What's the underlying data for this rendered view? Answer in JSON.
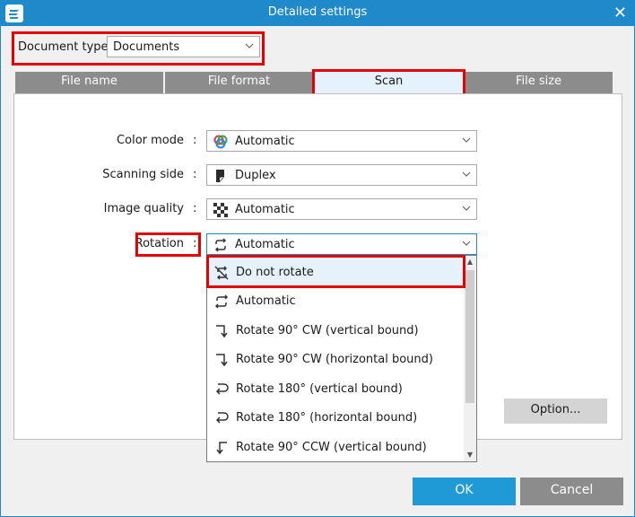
{
  "window": {
    "title": "Detailed settings"
  },
  "document_type": {
    "label": "Document type:",
    "value": "Documents"
  },
  "tabs": [
    {
      "label": "File name"
    },
    {
      "label": "File format"
    },
    {
      "label": "Scan"
    },
    {
      "label": "File size"
    }
  ],
  "fields": {
    "color_mode": {
      "label": "Color mode",
      "value": "Automatic"
    },
    "scanning_side": {
      "label": "Scanning side",
      "value": "Duplex"
    },
    "image_quality": {
      "label": "Image quality",
      "value": "Automatic"
    },
    "rotation": {
      "label": "Rotation",
      "value": "Automatic"
    }
  },
  "colon": ":",
  "rotation_options": [
    {
      "label": "Do not rotate"
    },
    {
      "label": "Automatic"
    },
    {
      "label": "Rotate 90° CW (vertical bound)"
    },
    {
      "label": "Rotate 90° CW (horizontal bound)"
    },
    {
      "label": "Rotate 180° (vertical bound)"
    },
    {
      "label": "Rotate 180° (horizontal bound)"
    },
    {
      "label": "Rotate 90° CCW (vertical bound)"
    }
  ],
  "buttons": {
    "option": "Option...",
    "ok": "OK",
    "cancel": "Cancel"
  },
  "colors": {
    "accent": "#1f8ac9",
    "ok": "#1f9ad6",
    "highlight": "#e60000",
    "tab_inactive": "#8c8c8c",
    "selected_bg": "#e5f1fb"
  }
}
